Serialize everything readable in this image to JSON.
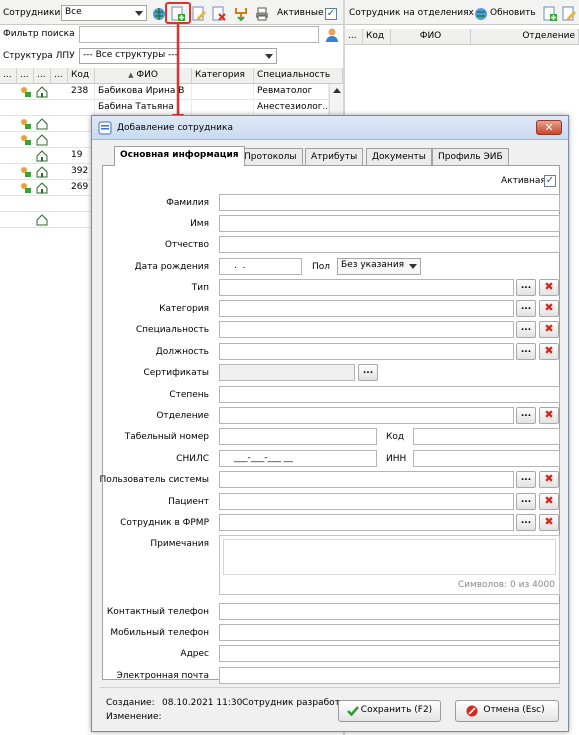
{
  "left_toolbar": {
    "employees_label": "Сотрудники",
    "filter_value": "Все",
    "active_label": "Активные",
    "active_checked": "✓"
  },
  "right_toolbar": {
    "title": "Сотрудник на отделениях",
    "refresh_label": "Обновить",
    "columns": [
      "...",
      "Код",
      "ФИО",
      "Отделение"
    ]
  },
  "search": {
    "label": "Фильтр поиска",
    "value": ""
  },
  "structure": {
    "label": "Структура ЛПУ",
    "value": "--- Все структуры ---"
  },
  "grid": {
    "columns": [
      "...",
      "...",
      "...",
      "...",
      "Код",
      "ФИО",
      "Категория",
      "Специальность"
    ],
    "sort_marker": "▲",
    "rows": [
      {
        "code": "238",
        "fio": "Бабикова Ирина В",
        "category": "",
        "spec": "Ревматолог"
      },
      {
        "code": "",
        "fio": "Бабина Татьяна",
        "category": "",
        "spec": "Анестезиолог..."
      },
      {
        "code": "",
        "fio": "",
        "category": "",
        "spec": ""
      },
      {
        "code": "",
        "fio": "",
        "category": "",
        "spec": ""
      },
      {
        "code": "19",
        "fio": "",
        "category": "",
        "spec": ""
      },
      {
        "code": "392",
        "fio": "",
        "category": "",
        "spec": ""
      },
      {
        "code": "269",
        "fio": "",
        "category": "",
        "spec": ""
      },
      {
        "code": "",
        "fio": "",
        "category": "",
        "spec": ""
      },
      {
        "code": "",
        "fio": "",
        "category": "",
        "spec": ""
      }
    ]
  },
  "dialog": {
    "title": "Добавление сотрудника",
    "close": "✕",
    "tabs": [
      "Основная информация",
      "Протоколы",
      "Атрибуты",
      "Документы",
      "Профиль ЭИБ"
    ],
    "active_label": "Активная",
    "active_checked": "✓",
    "fields": {
      "surname": "Фамилия",
      "name": "Имя",
      "patronymic": "Отчество",
      "birth_date": "Дата рождения",
      "birth_date_value": ".  .",
      "gender": "Пол",
      "gender_value": "Без указания",
      "type": "Тип",
      "category": "Категория",
      "specialty": "Специальность",
      "position": "Должность",
      "certificates": "Сертификаты",
      "degree": "Степень",
      "department": "Отделение",
      "tab_number": "Табельный номер",
      "code": "Код",
      "snils": "СНИЛС",
      "snils_value": "___-___-___ __",
      "inn": "ИНН",
      "system_user": "Пользователь системы",
      "patient": "Пациент",
      "frmr": "Сотрудник в ФРМР",
      "notes": "Примечания",
      "notes_counter": "Символов: 0 из 4000",
      "contact_phone": "Контактный телефон",
      "mobile_phone": "Мобильный телефон",
      "address": "Адрес",
      "email": "Электронная почта"
    },
    "ellipsis": "...",
    "clear": "✖",
    "footer": {
      "created_label": "Создание:",
      "created_value": "08.10.2021 11:30",
      "created_by": "Сотрудник разработ",
      "changed_label": "Изменение:",
      "save_label": "Сохранить (F2)",
      "cancel_label": "Отмена (Esc)"
    }
  },
  "colors": {
    "accent_red": "#e0312b",
    "dialog_title": "#c9daf0",
    "clear_red": "#d8261c",
    "save_green": "#2f9e2f"
  }
}
